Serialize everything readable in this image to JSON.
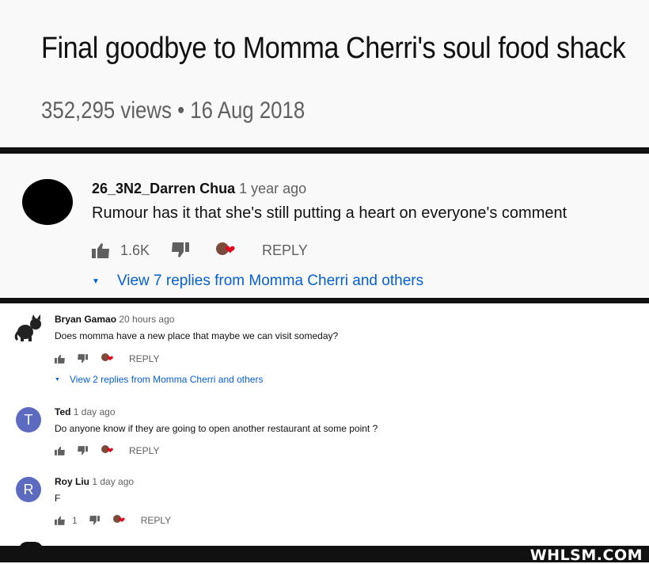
{
  "video": {
    "title": "Final goodbye to Momma Cherri's soul food shack",
    "meta": "352,295 views • 16 Aug 2018"
  },
  "top_comment": {
    "author": "26_3N2_Darren Chua",
    "time": "1 year ago",
    "text": "Rumour has it that she's still putting a heart on everyone's comment",
    "likes": "1.6K",
    "reply_label": "REPLY",
    "view_replies": "View 7 replies from Momma Cherri and others"
  },
  "comments": [
    {
      "author": "Bryan Gamao",
      "time": "20 hours ago",
      "text": "Does momma have a new place that maybe we can visit someday?",
      "likes": "",
      "reply_label": "REPLY",
      "view_replies": "View 2 replies from Momma Cherri and others"
    },
    {
      "author": "Ted",
      "time": "1 day ago",
      "avatar_letter": "T",
      "text": "Do anyone know if they are going to open another restaurant at some point ?",
      "likes": "",
      "reply_label": "REPLY"
    },
    {
      "author": "Roy Liu",
      "time": "1 day ago",
      "avatar_letter": "R",
      "text": "F",
      "likes": "1",
      "reply_label": "REPLY"
    }
  ],
  "watermark": "WHLSM.COM",
  "icons": [
    "thumb-up-icon",
    "thumb-down-icon",
    "creator-heart-icon",
    "chevron-down-icon"
  ],
  "colors": {
    "link": "#065fd4",
    "heart": "#e0061e",
    "avatar": "#5c6bc0"
  }
}
